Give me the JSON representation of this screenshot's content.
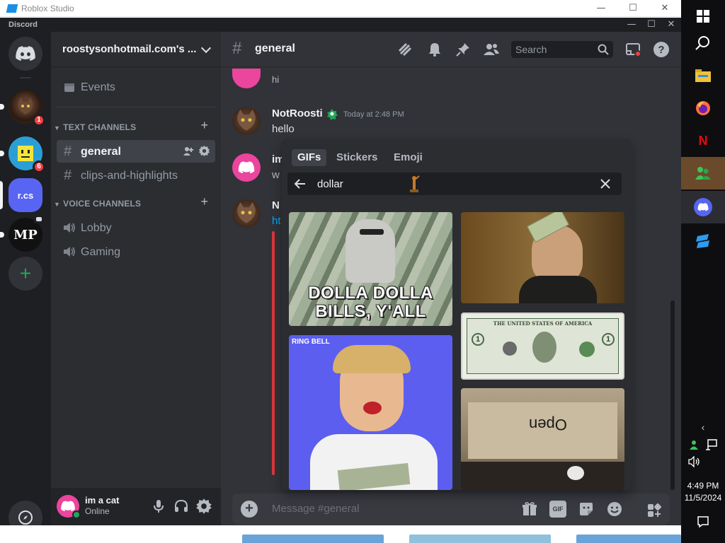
{
  "outer_window": {
    "title": "Roblox Studio",
    "controls": [
      "—",
      "☐",
      "✕"
    ]
  },
  "discord": {
    "brand": "Discord",
    "window_controls": [
      "—",
      "☐",
      "✕"
    ],
    "servers": [
      {
        "name": "Direct Messages",
        "icon": "discord-logo-icon"
      },
      {
        "name": "cat server",
        "badge": "1"
      },
      {
        "name": "smiley server",
        "badge": "6"
      },
      {
        "name": "r.cs",
        "label": "r.cs",
        "color": "#5865f2"
      },
      {
        "name": "MP server",
        "label": "MP"
      },
      {
        "name": "Add a Server",
        "icon": "plus-icon"
      },
      {
        "name": "Explore",
        "icon": "compass-icon"
      }
    ],
    "guild": {
      "name": "roostysonhotmail.com's ...",
      "events_label": "Events",
      "text_category": "TEXT CHANNELS",
      "text_channels": [
        {
          "name": "general",
          "active": true
        },
        {
          "name": "clips-and-highlights",
          "active": false
        }
      ],
      "voice_category": "VOICE CHANNELS",
      "voice_channels": [
        {
          "name": "Lobby"
        },
        {
          "name": "Gaming"
        }
      ]
    },
    "user": {
      "name": "im a cat",
      "status": "Online"
    },
    "channel": {
      "hash": "#",
      "name": "general",
      "search_placeholder": "Search"
    },
    "messages": [
      {
        "author": "",
        "text": "hi"
      },
      {
        "author": "NotRoosti",
        "timestamp": "Today at 2:48 PM",
        "text": "hello"
      },
      {
        "author": "im",
        "text": "w"
      },
      {
        "author": "N",
        "text": "ht"
      }
    ],
    "composer": {
      "placeholder": "Message #general",
      "gif_label": "GIF"
    },
    "gif_picker": {
      "tabs": [
        "GIFs",
        "Stickers",
        "Emoji"
      ],
      "active_tab": "GIFs",
      "query": "dollar",
      "results": [
        {
          "caption_line1": "DOLLA DOLLA",
          "caption_line2": "BILLS, Y'ALL"
        },
        {
          "caption_line1": "",
          "caption_line2": ""
        },
        {
          "caption_line1": "",
          "caption_line2": "",
          "watermark": "RING BELL"
        },
        {
          "caption_line1": "",
          "caption_line2": "",
          "note": "THE UNITED STATES OF AMERICA"
        },
        {
          "caption_line1": "",
          "caption_line2": "",
          "box_text": "Open"
        }
      ]
    }
  },
  "taskbar": {
    "time": "4:49 PM",
    "date": "11/5/2024"
  },
  "colors": {
    "blurple": "#5865f2",
    "green": "#23a55a",
    "red": "#f23f43",
    "sidebar": "#2b2d31",
    "chat_bg": "#313338"
  }
}
